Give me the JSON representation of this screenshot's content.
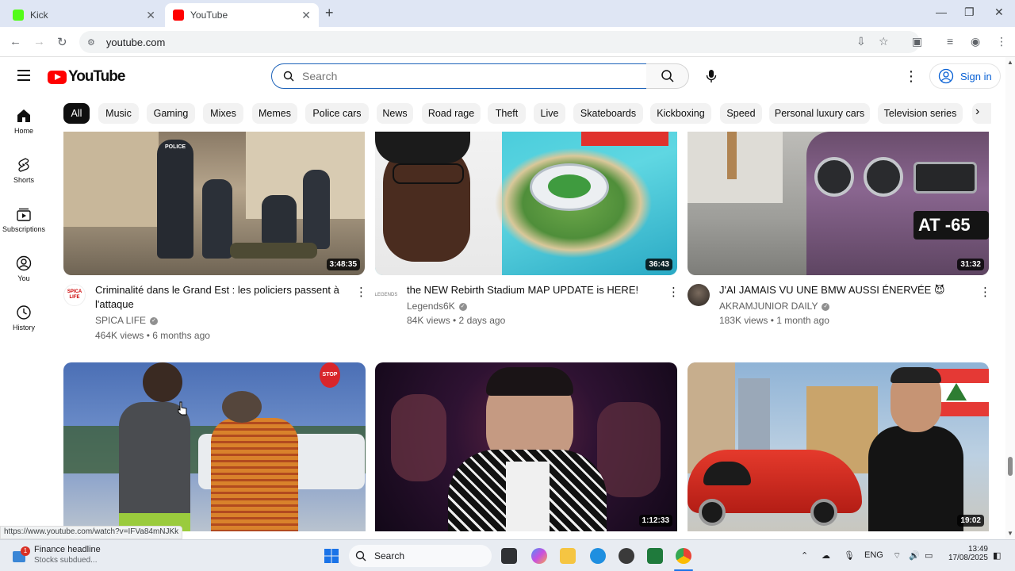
{
  "browser": {
    "tabs": [
      {
        "title": "Kick",
        "active": false
      },
      {
        "title": "YouTube",
        "active": true
      }
    ],
    "address": "youtube.com",
    "status_url": "https://www.youtube.com/watch?v=IFVa84mNJKk"
  },
  "header": {
    "logo_text": "YouTube",
    "search_placeholder": "Search",
    "signin_label": "Sign in"
  },
  "sidebar": {
    "items": [
      {
        "label": "Home",
        "icon": "home-icon"
      },
      {
        "label": "Shorts",
        "icon": "shorts-icon"
      },
      {
        "label": "Subscriptions",
        "icon": "subscriptions-icon"
      },
      {
        "label": "You",
        "icon": "you-icon"
      },
      {
        "label": "History",
        "icon": "history-icon"
      }
    ]
  },
  "chips": [
    "All",
    "Music",
    "Gaming",
    "Mixes",
    "Memes",
    "Police cars",
    "News",
    "Road rage",
    "Theft",
    "Live",
    "Skateboards",
    "Kickboxing",
    "Speed",
    "Personal luxury cars",
    "Television series"
  ],
  "videos": [
    {
      "title_line1": "Criminalité dans le Grand Est : les policiers passent à",
      "title_line2": "l'attaque",
      "channel": "SPICA LIFE",
      "meta": "464K views • 6 months ago",
      "duration": "3:48:35",
      "avatar_text": "SPICA LIFE"
    },
    {
      "title_line1": "the NEW Rebirth Stadium MAP UPDATE is HERE!",
      "title_line2": "",
      "channel": "Legends6K",
      "meta": "84K views • 2 days ago",
      "duration": "36:43",
      "avatar_text": "LEGENDS"
    },
    {
      "title_line1": "J'AI JAMAIS VU UNE BMW AUSSI ÉNERVÉE 😈",
      "title_line2": "",
      "channel": "AKRAMJUNIOR DAILY",
      "meta": "183K views • 1 month ago",
      "duration": "31:32",
      "avatar_text": ""
    },
    {
      "duration": ""
    },
    {
      "duration": "1:12:33"
    },
    {
      "duration": "19:02"
    }
  ],
  "thumb_texts": {
    "plate_bmw": "AT -65",
    "police_vest": "POLICE",
    "stop_sign": "STOP"
  },
  "taskbar": {
    "news_title": "Finance headline",
    "news_sub": "Stocks subdued...",
    "news_badge": "1",
    "search_label": "Search",
    "lang": "ENG",
    "time": "13:49",
    "date": "17/08/2025"
  },
  "colors": {
    "accent": "#065fd4",
    "brand": "#ff0000"
  }
}
